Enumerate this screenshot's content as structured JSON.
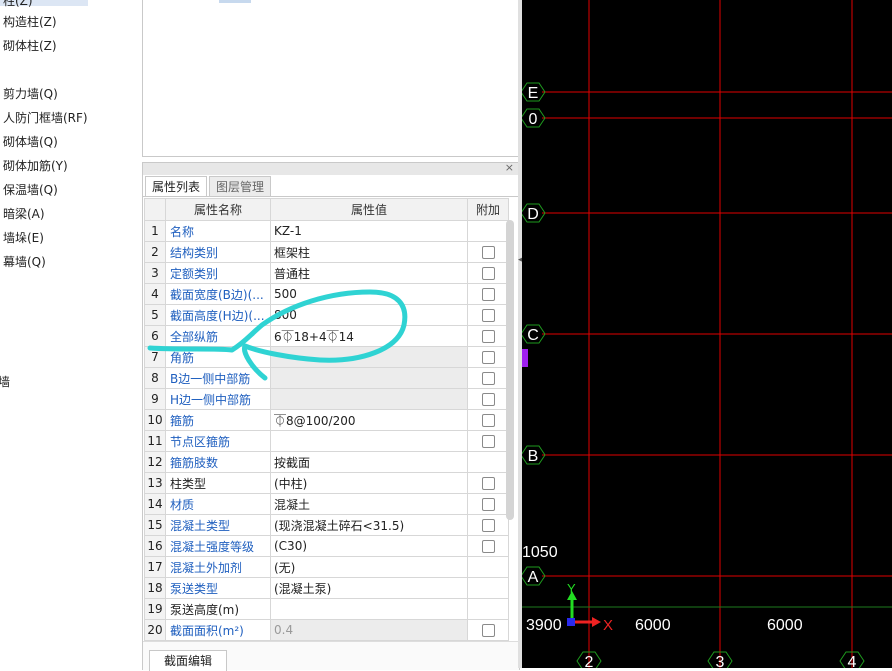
{
  "nav": {
    "items": [
      {
        "label": "柱(Z)"
      },
      {
        "label": "构造柱(Z)"
      },
      {
        "label": "砌体柱(Z)"
      },
      {
        "label": "剪力墙(Q)"
      },
      {
        "label": "人防门框墙(RF)"
      },
      {
        "label": "砌体墙(Q)"
      },
      {
        "label": "砌体加筋(Y)"
      },
      {
        "label": "保温墙(Q)"
      },
      {
        "label": "暗梁(A)"
      },
      {
        "label": "墙垛(E)"
      },
      {
        "label": "幕墙(Q)"
      },
      {
        "label": "墙"
      }
    ]
  },
  "panel": {
    "close": "×",
    "tabs": [
      {
        "label": "属性列表"
      },
      {
        "label": "图层管理"
      }
    ],
    "headers": {
      "name": "属性名称",
      "value": "属性值",
      "extra": "附加"
    },
    "rows": [
      {
        "num": "1",
        "name": "名称",
        "value": "KZ-1"
      },
      {
        "num": "2",
        "name": "结构类别",
        "value": "框架柱"
      },
      {
        "num": "3",
        "name": "定额类别",
        "value": "普通柱"
      },
      {
        "num": "4",
        "name": "截面宽度(B边)(...",
        "value": "500"
      },
      {
        "num": "5",
        "name": "截面高度(H边)(...",
        "value": "800"
      },
      {
        "num": "6",
        "name": "全部纵筋",
        "value": "6⏁18+4⏁14"
      },
      {
        "num": "7",
        "name": "角筋",
        "value": ""
      },
      {
        "num": "8",
        "name": "B边一侧中部筋",
        "value": ""
      },
      {
        "num": "9",
        "name": "H边一侧中部筋",
        "value": ""
      },
      {
        "num": "10",
        "name": "箍筋",
        "value": "⏁8@100/200"
      },
      {
        "num": "11",
        "name": "节点区箍筋",
        "value": ""
      },
      {
        "num": "12",
        "name": "箍筋肢数",
        "value": "按截面"
      },
      {
        "num": "13",
        "name": "柱类型",
        "value": "(中柱)"
      },
      {
        "num": "14",
        "name": "材质",
        "value": "混凝土"
      },
      {
        "num": "15",
        "name": "混凝土类型",
        "value": "(现浇混凝土碎石<31.5)"
      },
      {
        "num": "16",
        "name": "混凝土强度等级",
        "value": "(C30)"
      },
      {
        "num": "17",
        "name": "混凝土外加剂",
        "value": "(无)"
      },
      {
        "num": "18",
        "name": "泵送类型",
        "value": "(混凝土泵)"
      },
      {
        "num": "19",
        "name": "泵送高度(m)",
        "value": ""
      },
      {
        "num": "20",
        "name": "截面面积(m²)",
        "value": "0.4"
      }
    ],
    "button": "截面编辑"
  },
  "canvas": {
    "row_axis_labels": [
      "E",
      "0",
      "D",
      "C",
      "B",
      "A"
    ],
    "col_axis_labels": [
      "2",
      "3",
      "4"
    ],
    "dim_labels": [
      "1050",
      "3900",
      "6000",
      "6000"
    ],
    "coord_x": "X",
    "coord_y": "Y"
  }
}
